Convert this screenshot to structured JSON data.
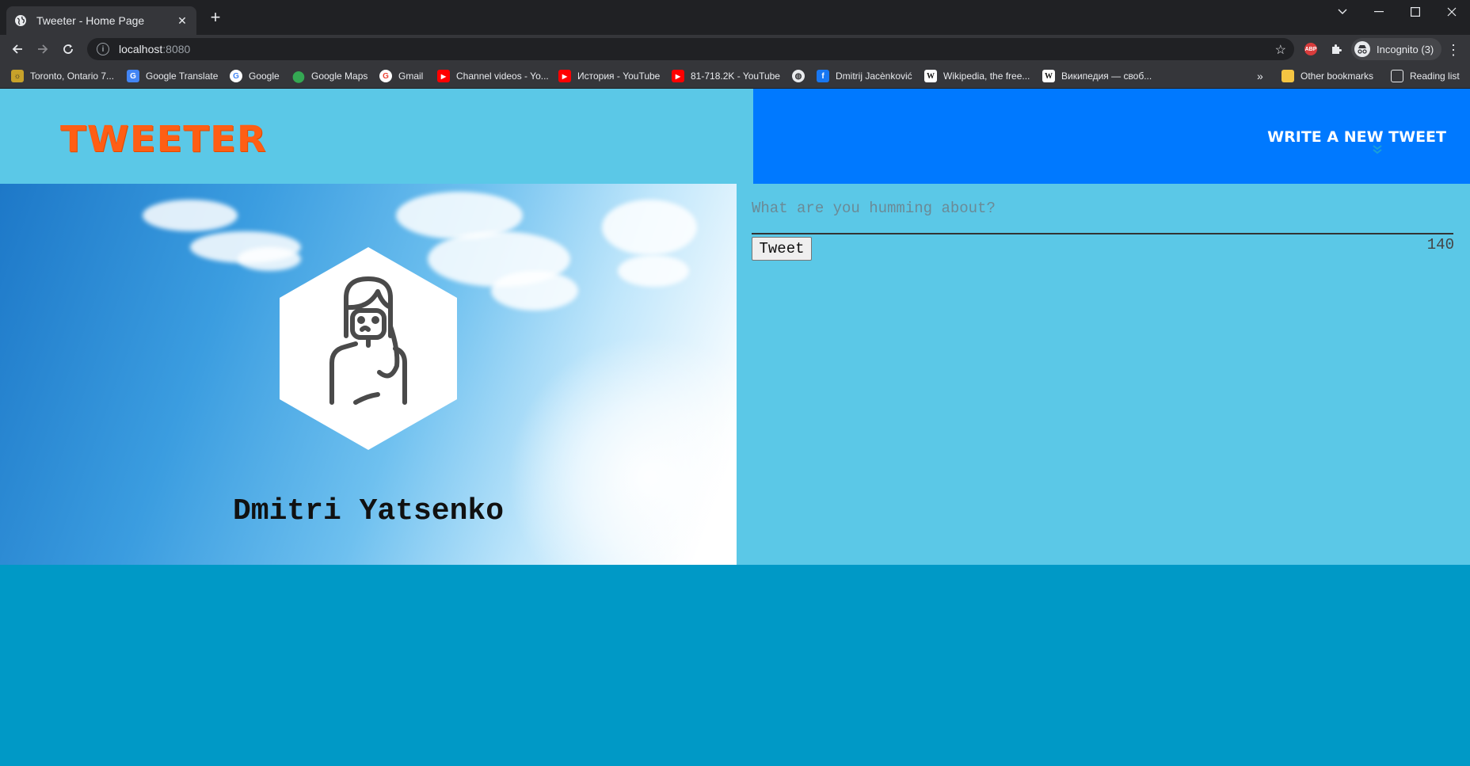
{
  "browser": {
    "tab_title": "Tweeter - Home Page",
    "url_host": "localhost",
    "url_port": ":8080",
    "profile_label": "Incognito (3)",
    "bookmarks": [
      {
        "label": "Toronto, Ontario 7...",
        "icon": "weather-icon"
      },
      {
        "label": "Google Translate",
        "icon": "translate-icon"
      },
      {
        "label": "Google",
        "icon": "google-icon"
      },
      {
        "label": "Google Maps",
        "icon": "maps-icon"
      },
      {
        "label": "Gmail",
        "icon": "google-icon"
      },
      {
        "label": "Channel videos - Yo...",
        "icon": "youtube-icon"
      },
      {
        "label": "История - YouTube",
        "icon": "youtube-icon"
      },
      {
        "label": "81-718.2K - YouTube",
        "icon": "youtube-icon"
      },
      {
        "label": "",
        "icon": "globe-icon"
      },
      {
        "label": "Dmitrij Jacènković",
        "icon": "facebook-icon"
      },
      {
        "label": "Wikipedia, the free...",
        "icon": "wikipedia-icon"
      },
      {
        "label": "Википедия — своб...",
        "icon": "wikipedia-icon"
      }
    ],
    "other_bookmarks": "Other bookmarks",
    "reading_list": "Reading list",
    "more": "»"
  },
  "header": {
    "logo": "TWEETER",
    "write_tweet": "Write a new tweet"
  },
  "profile": {
    "name": "Dmitri Yatsenko"
  },
  "compose": {
    "placeholder": "What are you humming about?",
    "button": "Tweet",
    "counter": "140"
  },
  "colors": {
    "header_left": "#5bc8e7",
    "header_right": "#0079ff",
    "logo": "#ff5e14",
    "page_bg": "#0099c6"
  }
}
